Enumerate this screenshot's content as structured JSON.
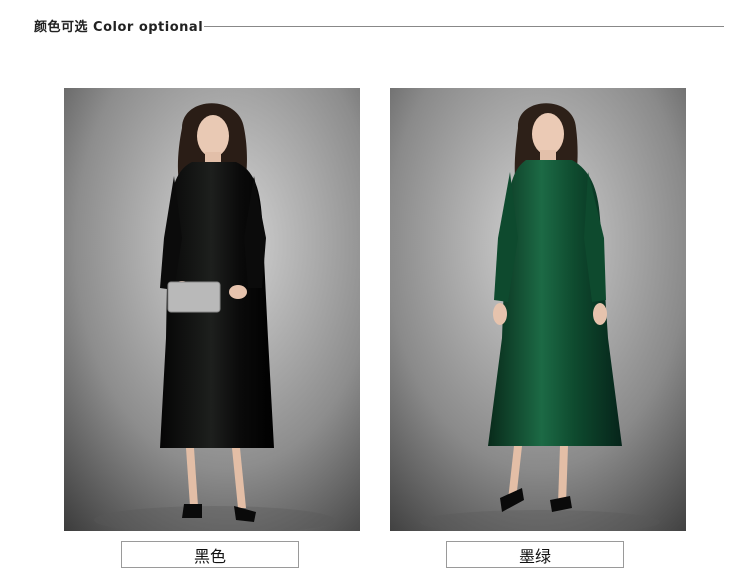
{
  "header": {
    "title": "颜色可选 Color optional"
  },
  "options": [
    {
      "label": "黑色",
      "dress_color": "#0c0d0c"
    },
    {
      "label": "墨绿",
      "dress_color": "#0f4a2e"
    }
  ],
  "colors": {
    "backdrop_light": "#cfcfcf",
    "backdrop_dark": "#3a3a3a",
    "rule": "#888888",
    "box_border": "#9a9a9a"
  }
}
